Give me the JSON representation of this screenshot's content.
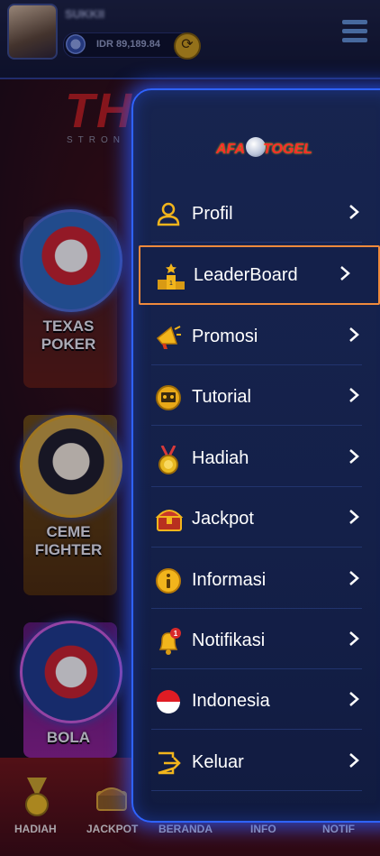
{
  "header": {
    "username": "SUKKII",
    "balance": "IDR 89,189.84"
  },
  "banner": {
    "title": "THE",
    "subtitle": "STRON"
  },
  "games": [
    {
      "label": "TEXAS\nPOKER"
    },
    {
      "label": "CEME\nFIGHTER"
    },
    {
      "label": "BOLA"
    }
  ],
  "bottom_nav": {
    "items": [
      {
        "label": "HADIAH"
      },
      {
        "label": "JACKPOT"
      },
      {
        "label": "BERANDA"
      },
      {
        "label": "INFO"
      },
      {
        "label": "NOTIF"
      }
    ]
  },
  "drawer": {
    "logo_left": "AFA",
    "logo_right": "TOGEL",
    "items": [
      {
        "label": "Profil",
        "icon": "profile-icon"
      },
      {
        "label": "LeaderBoard",
        "icon": "podium-icon"
      },
      {
        "label": "Promosi",
        "icon": "megaphone-icon"
      },
      {
        "label": "Tutorial",
        "icon": "tutorial-icon"
      },
      {
        "label": "Hadiah",
        "icon": "medal-icon"
      },
      {
        "label": "Jackpot",
        "icon": "treasure-chest-icon"
      },
      {
        "label": "Informasi",
        "icon": "info-icon"
      },
      {
        "label": "Notifikasi",
        "icon": "bell-icon",
        "badge": "1"
      },
      {
        "label": "Indonesia",
        "icon": "flag-icon"
      },
      {
        "label": "Keluar",
        "icon": "logout-icon"
      }
    ],
    "selected": "LeaderBoard"
  },
  "colors": {
    "drawer_border": "#2f63ff",
    "selected_outline": "#f08a3c",
    "accent_gold": "#f2b51c"
  }
}
